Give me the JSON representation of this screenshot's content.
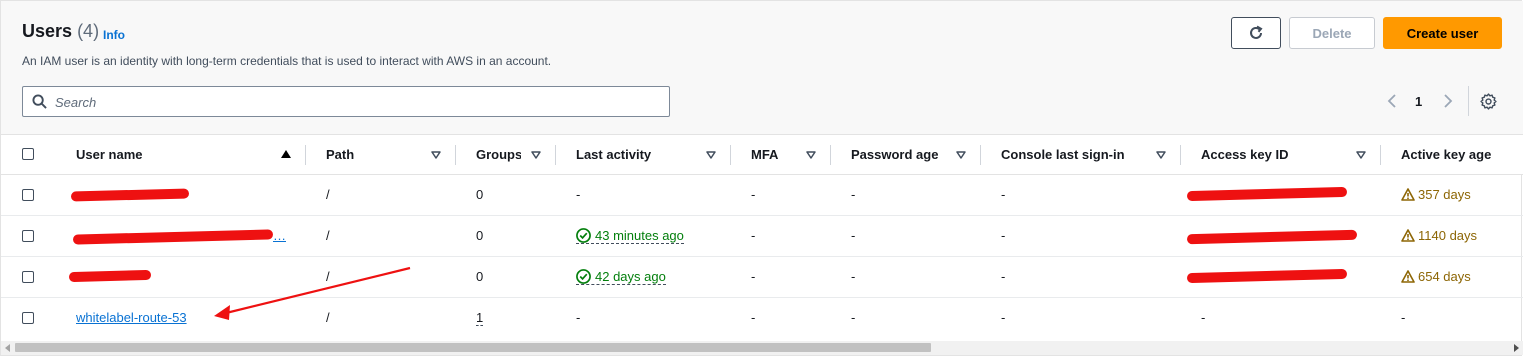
{
  "header": {
    "title": "Users",
    "count": "(4)",
    "info": "Info",
    "description": "An IAM user is an identity with long-term credentials that is used to interact with AWS in an account."
  },
  "buttons": {
    "refresh": "refresh-icon",
    "delete": "Delete",
    "create": "Create user"
  },
  "search": {
    "placeholder": "Search",
    "value": ""
  },
  "pagination": {
    "current_page": "1"
  },
  "table": {
    "columns": [
      "User name",
      "Path",
      "Groups",
      "Last activity",
      "MFA",
      "Password age",
      "Console last sign-in",
      "Access key ID",
      "Active key age"
    ],
    "sorted_column": "User name",
    "rows": [
      {
        "user_name": "",
        "path": "/",
        "groups": "0",
        "last_activity": "-",
        "mfa": "-",
        "password_age": "-",
        "console_sign_in": "-",
        "access_key_id": "",
        "active_key_age": "357 days"
      },
      {
        "user_name": "…",
        "path": "/",
        "groups": "0",
        "last_activity": "43 minutes ago",
        "mfa": "-",
        "password_age": "-",
        "console_sign_in": "-",
        "access_key_id": "",
        "active_key_age": "1140 days"
      },
      {
        "user_name": "",
        "path": "/",
        "groups": "0",
        "last_activity": "42 days ago",
        "mfa": "-",
        "password_age": "-",
        "console_sign_in": "-",
        "access_key_id": "",
        "active_key_age": "654 days"
      },
      {
        "user_name": "whitelabel-route-53",
        "path": "/",
        "groups": "1",
        "last_activity": "-",
        "mfa": "-",
        "password_age": "-",
        "console_sign_in": "-",
        "access_key_id": "-",
        "active_key_age": "-"
      }
    ]
  },
  "colors": {
    "primary": "#ff9900",
    "link": "#0972d3",
    "success": "#037f0c",
    "warning": "#8d6605",
    "annotation": "#ee1111"
  }
}
